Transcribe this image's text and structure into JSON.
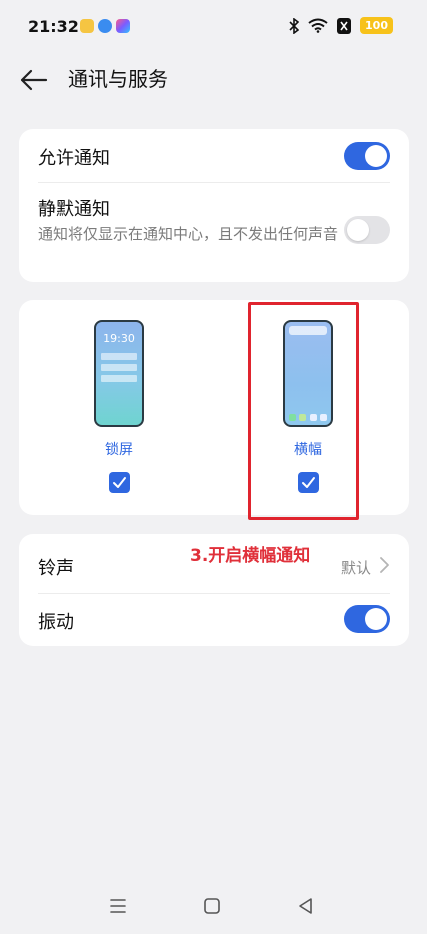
{
  "status_bar": {
    "time": "21:32",
    "battery": "100",
    "icons": [
      "app-notification-icon",
      "app-notification-icon",
      "app-notification-icon",
      "bluetooth-icon",
      "wifi-icon",
      "nfc-icon",
      "battery-icon"
    ]
  },
  "header": {
    "title": "通讯与服务",
    "back_icon": "back-arrow-icon"
  },
  "notifications": {
    "allow": {
      "label": "允许通知",
      "enabled": true
    },
    "silent": {
      "label": "静默通知",
      "description": "通知将仅显示在通知中心，且不发出任何声音",
      "enabled": false
    }
  },
  "styles": {
    "lock_screen": {
      "label": "锁屏",
      "preview_time": "19:30",
      "checked": true
    },
    "banner": {
      "label": "横幅",
      "checked": true
    }
  },
  "sound": {
    "ringtone": {
      "label": "铃声",
      "value": "默认"
    },
    "vibration": {
      "label": "振动",
      "enabled": true
    }
  },
  "annotation": {
    "text": "3.开启横幅通知",
    "color": "#e0242e"
  },
  "colors": {
    "accent": "#2f67e0",
    "background": "#f1f1f3"
  },
  "nav_bar": [
    "menu-icon",
    "home-icon",
    "back-triangle-icon"
  ]
}
